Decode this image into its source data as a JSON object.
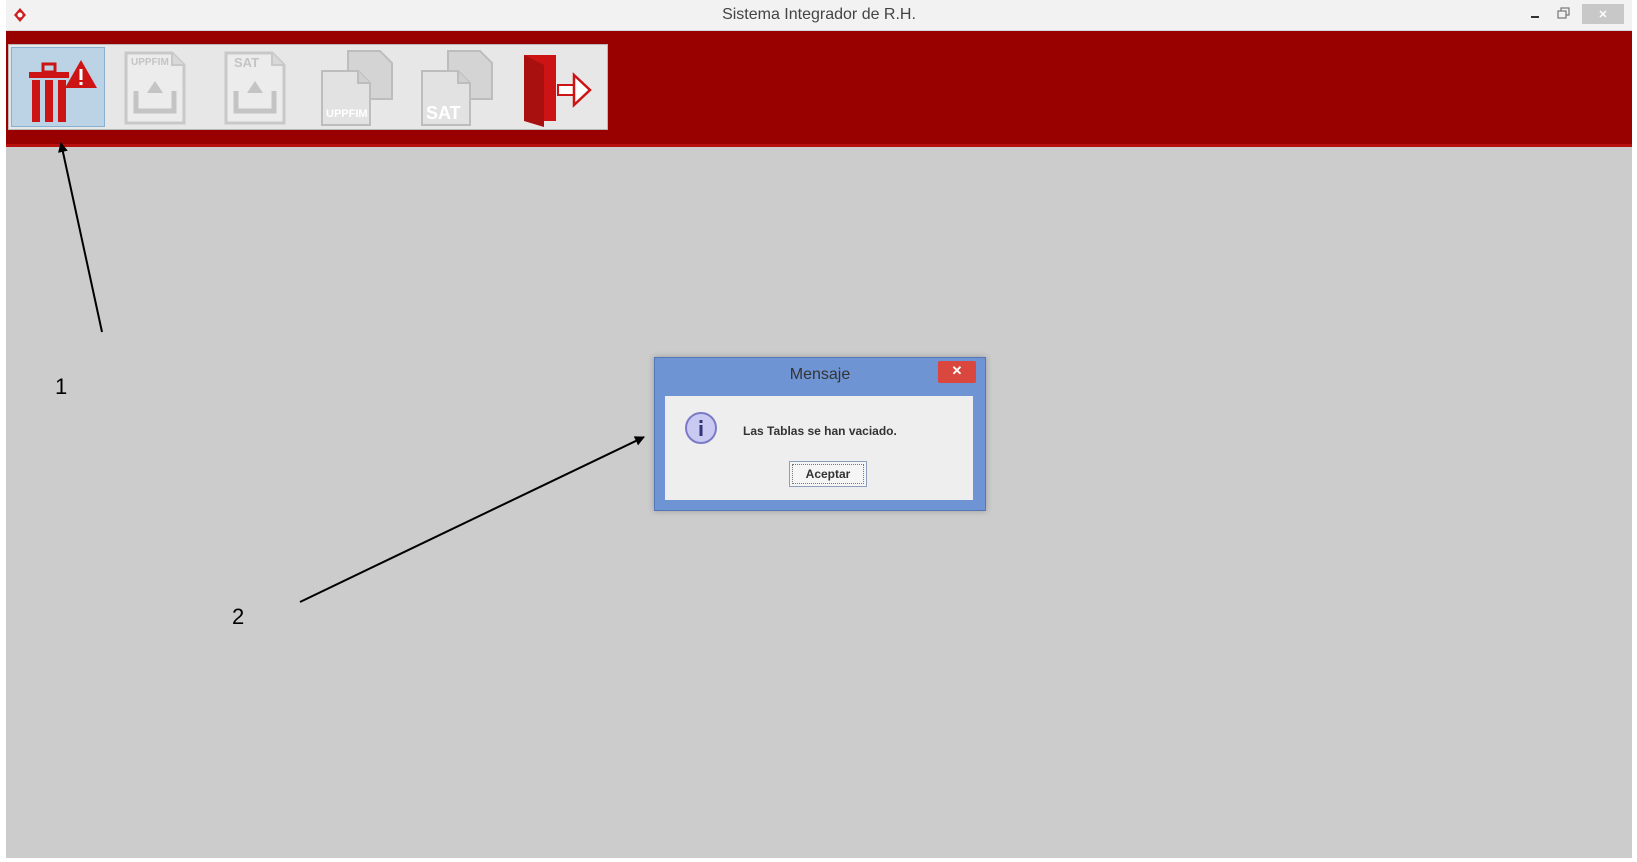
{
  "window": {
    "title": "Sistema Integrador de R.H.",
    "icons": {
      "app": "app-logo-icon",
      "minimize": "minimize-icon",
      "maximize": "maximize-icon",
      "close": "close-icon"
    }
  },
  "toolbar": {
    "background_color": "#990000",
    "buttons": [
      {
        "icon": "trash-warning-icon",
        "enabled": true,
        "selected": true
      },
      {
        "icon": "import-uppfim-icon",
        "icon_text": "UPPFIM",
        "enabled": false
      },
      {
        "icon": "import-sat-icon",
        "icon_text": "SAT",
        "enabled": false
      },
      {
        "icon": "document-uppfim-icon",
        "icon_text": "UPPFIM",
        "enabled": false
      },
      {
        "icon": "document-sat-icon",
        "icon_text": "SAT",
        "enabled": false
      },
      {
        "icon": "exit-door-icon",
        "enabled": true
      }
    ]
  },
  "dialog": {
    "title": "Mensaje",
    "message": "Las Tablas se han vaciado.",
    "accept_label": "Aceptar",
    "icons": {
      "info": "info-icon",
      "close": "close-icon"
    },
    "accent_color": "#6f94d4"
  },
  "annotations": {
    "callout_1": "1",
    "callout_2": "2"
  }
}
